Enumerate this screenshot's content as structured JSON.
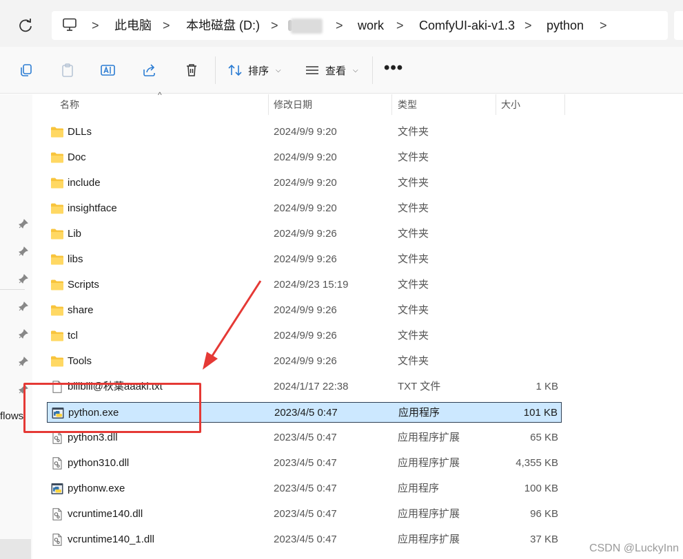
{
  "address": {
    "crumbs": [
      "此电脑",
      "本地磁盘 (D:)",
      "work",
      "ComfyUI-aki-v1.3",
      "python"
    ],
    "separator": ">"
  },
  "toolbar": {
    "sort_label": "排序",
    "view_label": "查看",
    "more_label": "•••"
  },
  "columns": {
    "name": "名称",
    "date": "修改日期",
    "type": "类型",
    "size": "大小"
  },
  "nav": {
    "flows_text": "flows"
  },
  "files": [
    {
      "name": "DLLs",
      "date": "2024/9/9 9:20",
      "type": "文件夹",
      "size": "",
      "icon": "folder-icon"
    },
    {
      "name": "Doc",
      "date": "2024/9/9 9:20",
      "type": "文件夹",
      "size": "",
      "icon": "folder-icon"
    },
    {
      "name": "include",
      "date": "2024/9/9 9:20",
      "type": "文件夹",
      "size": "",
      "icon": "folder-icon"
    },
    {
      "name": "insightface",
      "date": "2024/9/9 9:20",
      "type": "文件夹",
      "size": "",
      "icon": "folder-icon"
    },
    {
      "name": "Lib",
      "date": "2024/9/9 9:26",
      "type": "文件夹",
      "size": "",
      "icon": "folder-icon"
    },
    {
      "name": "libs",
      "date": "2024/9/9 9:26",
      "type": "文件夹",
      "size": "",
      "icon": "folder-icon"
    },
    {
      "name": "Scripts",
      "date": "2024/9/23 15:19",
      "type": "文件夹",
      "size": "",
      "icon": "folder-icon"
    },
    {
      "name": "share",
      "date": "2024/9/9 9:26",
      "type": "文件夹",
      "size": "",
      "icon": "folder-icon"
    },
    {
      "name": "tcl",
      "date": "2024/9/9 9:26",
      "type": "文件夹",
      "size": "",
      "icon": "folder-icon"
    },
    {
      "name": "Tools",
      "date": "2024/9/9 9:26",
      "type": "文件夹",
      "size": "",
      "icon": "folder-icon"
    },
    {
      "name": "bilibili@秋葉aaaki.txt",
      "date": "2024/1/17 22:38",
      "type": "TXT 文件",
      "size": "1 KB",
      "icon": "text-file-icon"
    },
    {
      "name": "python.exe",
      "date": "2023/4/5 0:47",
      "type": "应用程序",
      "size": "101 KB",
      "icon": "python-exe-icon",
      "selected": true
    },
    {
      "name": "python3.dll",
      "date": "2023/4/5 0:47",
      "type": "应用程序扩展",
      "size": "65 KB",
      "icon": "dll-file-icon"
    },
    {
      "name": "python310.dll",
      "date": "2023/4/5 0:47",
      "type": "应用程序扩展",
      "size": "4,355 KB",
      "icon": "dll-file-icon"
    },
    {
      "name": "pythonw.exe",
      "date": "2023/4/5 0:47",
      "type": "应用程序",
      "size": "100 KB",
      "icon": "python-exe-icon"
    },
    {
      "name": "vcruntime140.dll",
      "date": "2023/4/5 0:47",
      "type": "应用程序扩展",
      "size": "96 KB",
      "icon": "dll-file-icon"
    },
    {
      "name": "vcruntime140_1.dll",
      "date": "2023/4/5 0:47",
      "type": "应用程序扩展",
      "size": "37 KB",
      "icon": "dll-file-icon"
    }
  ],
  "watermark": "CSDN @LuckyInn",
  "colors": {
    "selection_bg": "#cce8ff",
    "annotation_red": "#e53935",
    "folder_yellow": "#f8c43c"
  }
}
